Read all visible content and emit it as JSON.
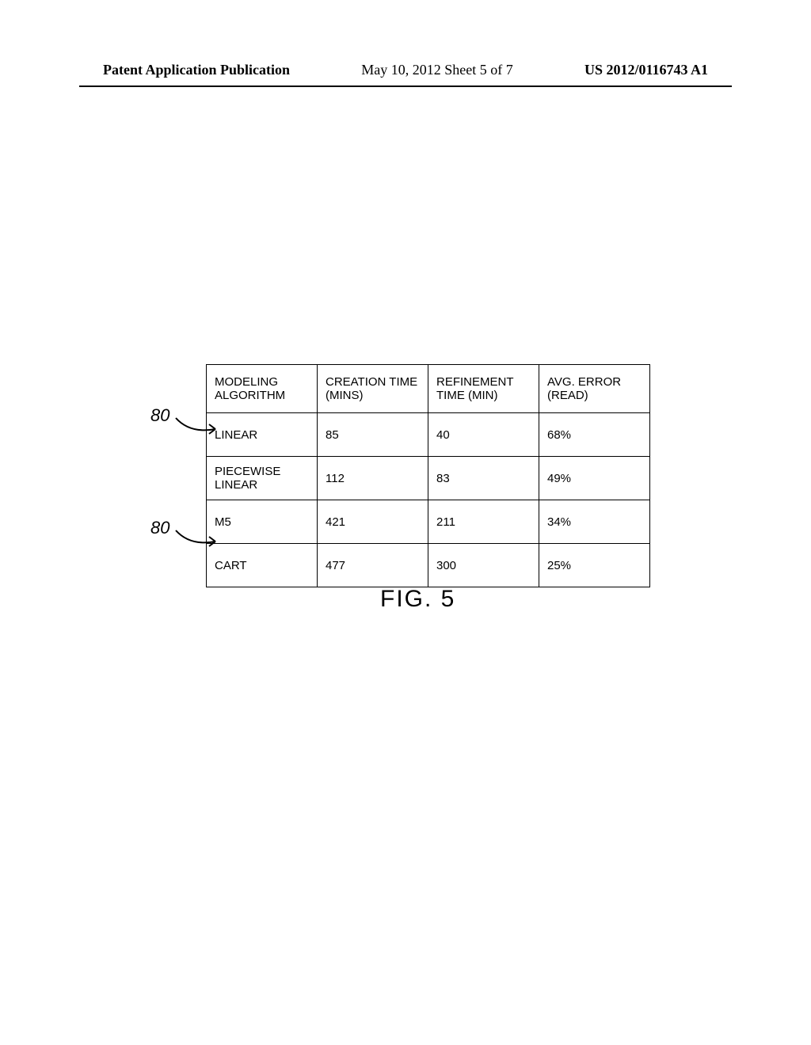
{
  "header": {
    "left": "Patent Application Publication",
    "center": "May 10, 2012  Sheet 5 of 7",
    "right": "US 2012/0116743 A1"
  },
  "callouts": {
    "ref1": "80",
    "ref2": "80"
  },
  "figure_label": "FIG. 5",
  "chart_data": {
    "type": "table",
    "title": "FIG. 5",
    "columns": [
      "MODELING ALGORITHM",
      "CREATION TIME (MINS)",
      "REFINEMENT TIME (MIN)",
      "AVG. ERROR (READ)"
    ],
    "rows": [
      {
        "algorithm": "LINEAR",
        "creation_time": "85",
        "refinement_time": "40",
        "avg_error": "68%"
      },
      {
        "algorithm": "PIECEWISE LINEAR",
        "creation_time": "112",
        "refinement_time": "83",
        "avg_error": "49%"
      },
      {
        "algorithm": "M5",
        "creation_time": "421",
        "refinement_time": "211",
        "avg_error": "34%"
      },
      {
        "algorithm": "CART",
        "creation_time": "477",
        "refinement_time": "300",
        "avg_error": "25%"
      }
    ]
  }
}
